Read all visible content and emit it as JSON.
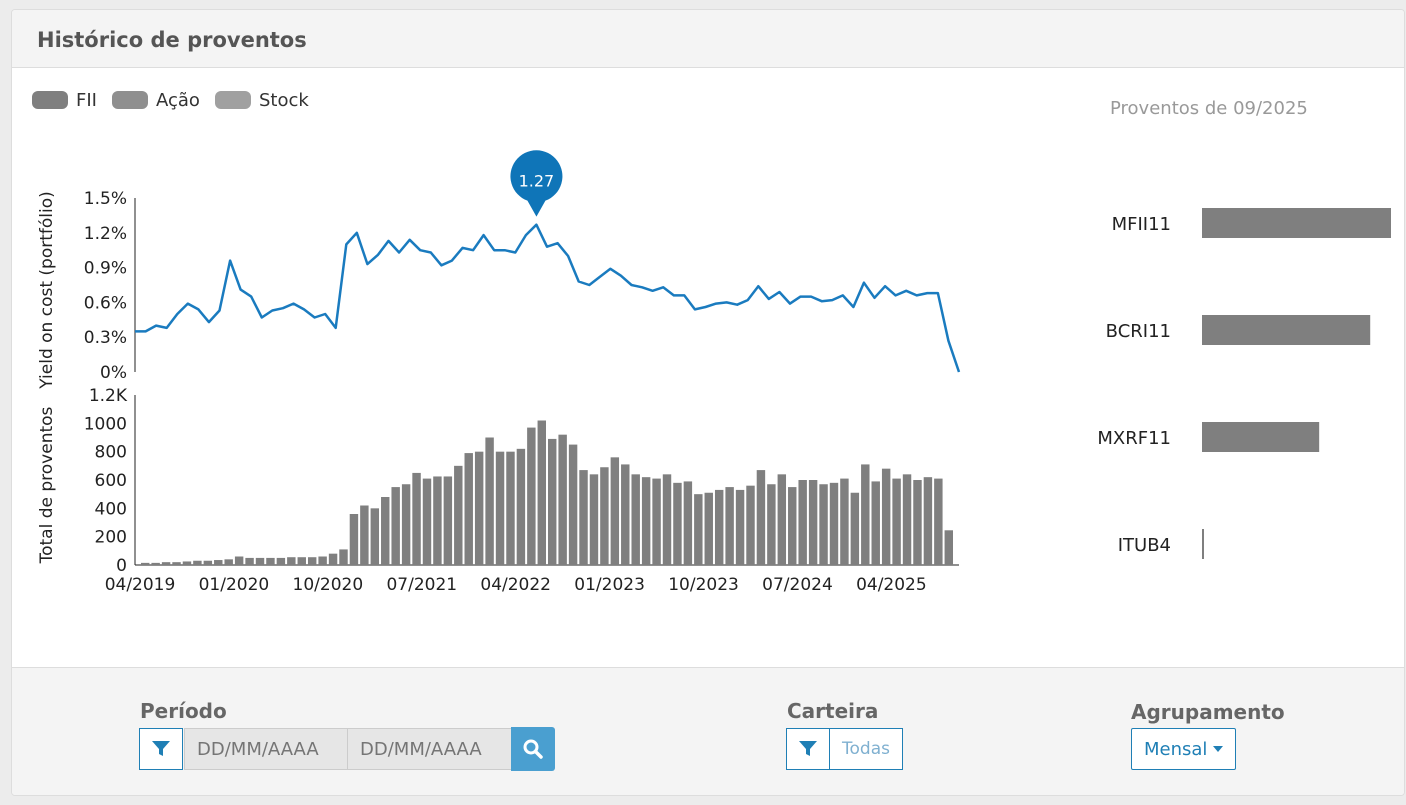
{
  "header": {
    "title": "Histórico de proventos"
  },
  "legend": [
    {
      "label": "FII",
      "color": "#7f7f7f"
    },
    {
      "label": "Ação",
      "color": "#8f8f8f"
    },
    {
      "label": "Stock",
      "color": "#a0a0a0"
    }
  ],
  "right_panel": {
    "title": "Proventos de 09/2025"
  },
  "chart_data": [
    {
      "type": "line",
      "ylabel": "Yield on cost (portfólio)",
      "ytick_labels": [
        "0%",
        "0.3%",
        "0.6%",
        "0.9%",
        "1.2%",
        "1.5%"
      ],
      "ylim": [
        0,
        1.5
      ],
      "x_start": "04/2019",
      "x_end": "09/2025",
      "series": [
        {
          "color": "#1a7bbf",
          "values": [
            0.35,
            0.35,
            0.4,
            0.38,
            0.5,
            0.59,
            0.54,
            0.43,
            0.53,
            0.96,
            0.71,
            0.65,
            0.47,
            0.53,
            0.55,
            0.59,
            0.54,
            0.47,
            0.5,
            0.38,
            1.1,
            1.2,
            0.93,
            1.01,
            1.13,
            1.03,
            1.14,
            1.05,
            1.03,
            0.92,
            0.96,
            1.07,
            1.05,
            1.18,
            1.05,
            1.05,
            1.03,
            1.18,
            1.27,
            1.08,
            1.11,
            1.0,
            0.78,
            0.75,
            0.82,
            0.89,
            0.83,
            0.75,
            0.73,
            0.7,
            0.73,
            0.66,
            0.66,
            0.54,
            0.56,
            0.59,
            0.6,
            0.58,
            0.62,
            0.74,
            0.63,
            0.69,
            0.59,
            0.65,
            0.65,
            0.61,
            0.62,
            0.66,
            0.56,
            0.77,
            0.64,
            0.74,
            0.66,
            0.7,
            0.66,
            0.68,
            0.68,
            0.27,
            0.0
          ]
        }
      ],
      "highlight": {
        "label": "1.27"
      }
    },
    {
      "type": "bar",
      "ylabel": "Total de proventos",
      "ytick_labels": [
        "0",
        "200",
        "400",
        "600",
        "800",
        "1000",
        "1.2K"
      ],
      "ylim": [
        0,
        1200
      ],
      "xtick_labels": [
        "04/2019",
        "01/2020",
        "10/2020",
        "07/2021",
        "04/2022",
        "01/2023",
        "10/2023",
        "07/2024",
        "04/2025"
      ],
      "values": [
        15,
        15,
        20,
        20,
        25,
        30,
        30,
        35,
        40,
        60,
        50,
        50,
        50,
        50,
        55,
        55,
        55,
        60,
        80,
        110,
        360,
        420,
        400,
        480,
        550,
        570,
        650,
        610,
        625,
        625,
        700,
        790,
        800,
        900,
        800,
        800,
        820,
        970,
        1020,
        890,
        920,
        850,
        670,
        640,
        690,
        760,
        710,
        640,
        620,
        610,
        640,
        580,
        590,
        500,
        510,
        530,
        550,
        530,
        560,
        670,
        570,
        640,
        550,
        600,
        600,
        570,
        580,
        610,
        510,
        710,
        590,
        680,
        610,
        640,
        600,
        620,
        610,
        245
      ],
      "ticker_labels": [
        "MFII11",
        "BCRI11",
        "MXRF11",
        "ITUB4"
      ],
      "ticker_values": [
        100,
        89,
        62,
        1
      ]
    }
  ],
  "footer": {
    "periodo_label": "Período",
    "date_start_placeholder": "DD/MM/AAAA",
    "date_end_placeholder": "DD/MM/AAAA",
    "carteira_label": "Carteira",
    "carteira_value": "Todas",
    "agrupamento_label": "Agrupamento",
    "agrupamento_value": "Mensal"
  }
}
